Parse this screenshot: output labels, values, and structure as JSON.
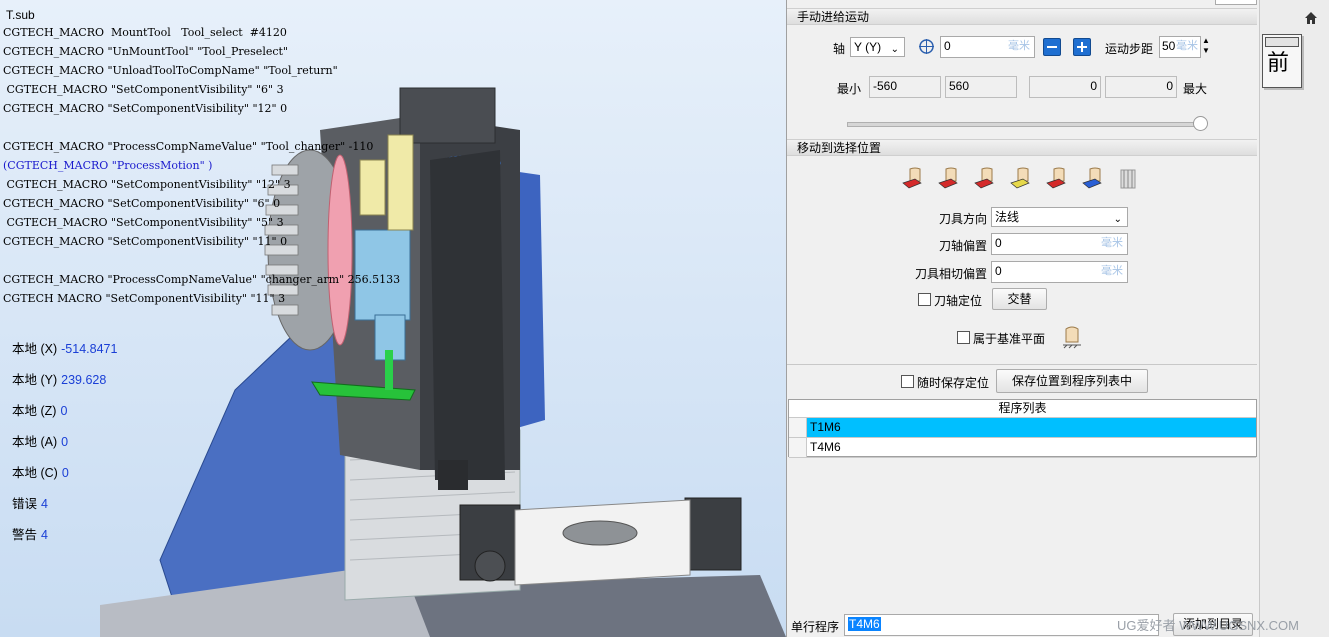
{
  "viewport": {
    "title": "T.sub",
    "log_lines": [
      "CGTECH_MACRO  MountTool   Tool_select  #4120",
      "CGTECH_MACRO \"UnMountTool\" \"Tool_Preselect\"",
      "CGTECH_MACRO \"UnloadToolToCompName\" \"Tool_return\"",
      " CGTECH_MACRO \"SetComponentVisibility\" \"6\" 3",
      "CGTECH_MACRO \"SetComponentVisibility\" \"12\" 0",
      "",
      "CGTECH_MACRO \"ProcessCompNameValue\" \"Tool_changer\" -110",
      "(CGTECH_MACRO \"ProcessMotion\" )",
      " CGTECH_MACRO \"SetComponentVisibility\" \"12\" 3",
      "CGTECH_MACRO \"SetComponentVisibility\" \"6\" 0",
      " CGTECH_MACRO \"SetComponentVisibility\" \"5\" 3",
      "CGTECH_MACRO \"SetComponentVisibility\" \"11\" 0",
      "",
      "CGTECH_MACRO \"ProcessCompNameValue\" \"changer_arm\" 256.5133",
      "CGTECH MACRO \"SetComponentVisibility\" \"11\" 3"
    ],
    "status": [
      {
        "label": "本地 (X)",
        "value": "-514.8471"
      },
      {
        "label": "本地 (Y)",
        "value": "239.628"
      },
      {
        "label": "本地 (Z)",
        "value": "0"
      },
      {
        "label": "本地 (A)",
        "value": "0"
      },
      {
        "label": "本地 (C)",
        "value": "0"
      },
      {
        "label": "错误",
        "value": "4"
      },
      {
        "label": "警告",
        "value": "4"
      }
    ]
  },
  "manual_feed": {
    "header": "手动进给运动",
    "axis_label": "轴",
    "axis_value": "Y (Y)",
    "position_value": "0",
    "unit": "毫米",
    "step_label": "运动步距",
    "step_value": "50",
    "min_label": "最小",
    "max_label": "最大",
    "min_value": "-560",
    "max_value": "560",
    "field3": "0",
    "field4": "0"
  },
  "move_to": {
    "header": "移动到选择位置",
    "tool_dir_label": "刀具方向",
    "tool_dir_value": "法线",
    "axis_offset_label": "刀轴偏置",
    "axis_offset_value": "0",
    "tangent_offset_label": "刀具相切偏置",
    "tangent_offset_value": "0",
    "axis_lock_label": "刀轴定位",
    "swap_button": "交替",
    "belongs_plane_label": "属于基准平面",
    "save_anytime_label": "随时保存定位",
    "save_to_list_button": "保存位置到程序列表中"
  },
  "program_list": {
    "header": "程序列表",
    "rows": [
      "T1M6",
      "T4M6"
    ],
    "selected_index": 0
  },
  "single_program": {
    "label": "单行程序",
    "value": "T4M6",
    "add_button": "添加到目录"
  },
  "right_strip": {
    "front_label": "前"
  },
  "watermark": "UG爱好者 WWW.UGSNX.COM",
  "colors": {
    "selected_row": "#00bfff",
    "value_blue": "#1a3fd6",
    "highlight_blue": "#1a1acd"
  }
}
